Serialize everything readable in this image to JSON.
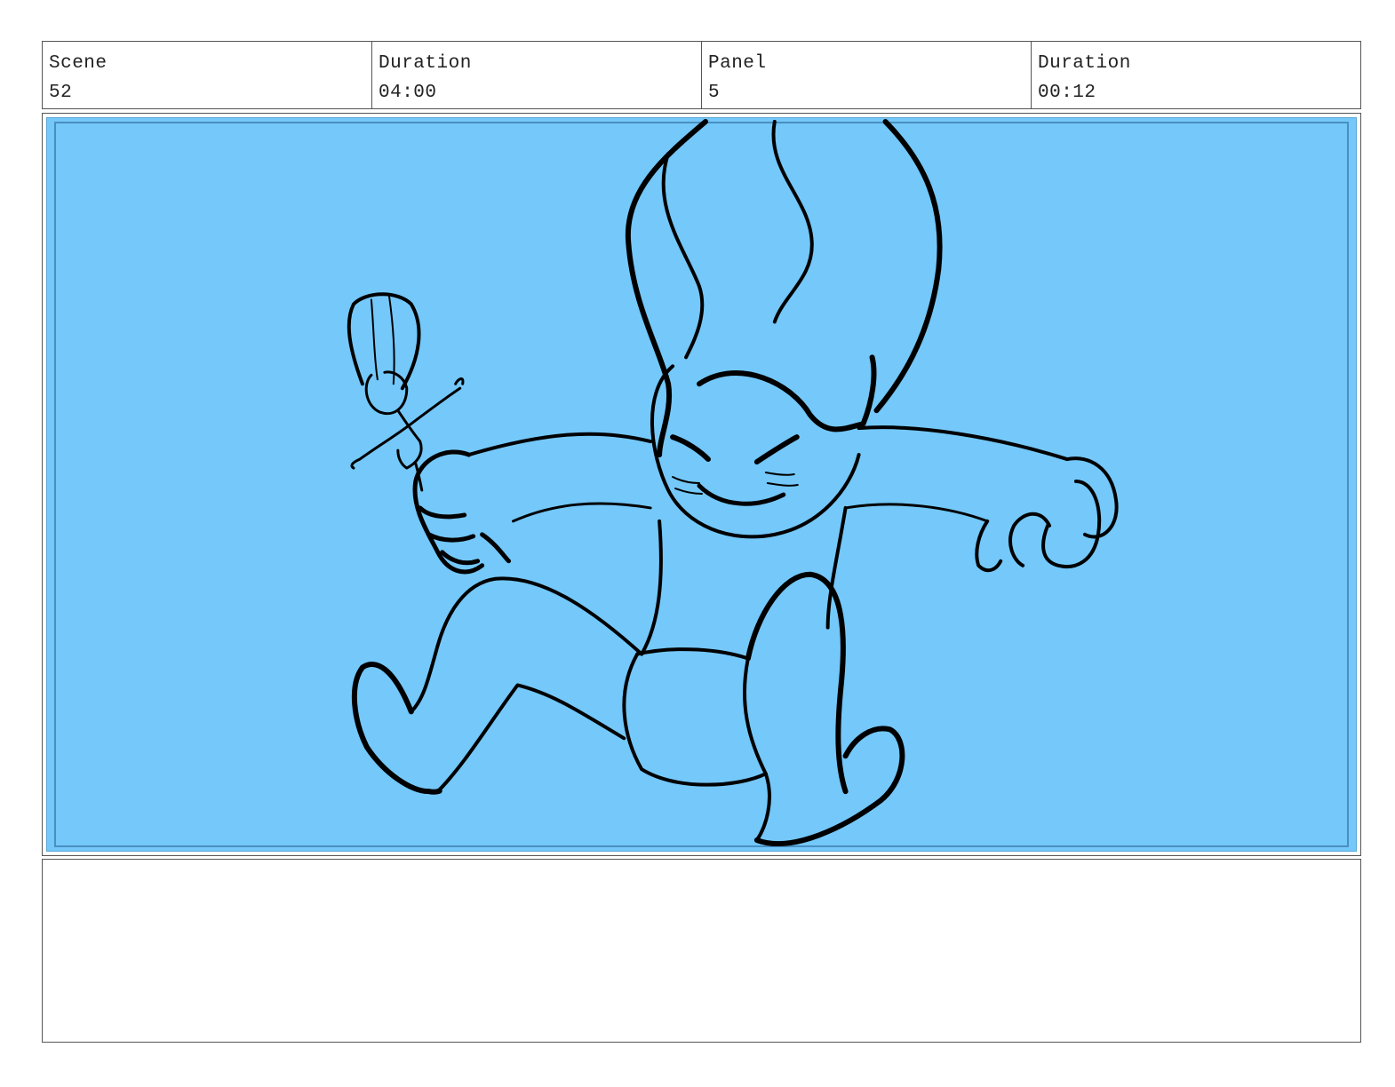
{
  "header": {
    "scene_label": "Scene",
    "scene_value": "52",
    "scene_duration_label": "Duration",
    "scene_duration_value": "04:00",
    "panel_label": "Panel",
    "panel_value": "5",
    "panel_duration_label": "Duration",
    "panel_duration_value": "00:12"
  },
  "panel": {
    "background_color": "#74c8fa",
    "line_color": "#000000"
  },
  "notes": {
    "text": ""
  }
}
